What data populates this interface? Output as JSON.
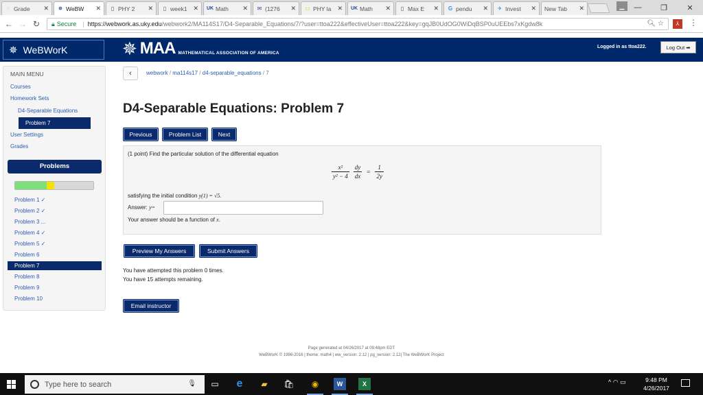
{
  "browser": {
    "tabs": [
      {
        "label": "Grade",
        "icon": "loading-icon"
      },
      {
        "label": "WeBW",
        "icon": "webwork-icon",
        "active": true
      },
      {
        "label": "PHY 2",
        "icon": "page-icon"
      },
      {
        "label": "week1",
        "icon": "page-icon"
      },
      {
        "label": "Math",
        "icon": "uk-icon"
      },
      {
        "label": "(1276",
        "icon": "mail-icon"
      },
      {
        "label": "PHY la",
        "icon": "slides-icon"
      },
      {
        "label": "Math",
        "icon": "uk-icon"
      },
      {
        "label": "Max E",
        "icon": "page-icon"
      },
      {
        "label": "pendu",
        "icon": "google-icon"
      },
      {
        "label": "Invest",
        "icon": "bird-icon"
      },
      {
        "label": "New Tab",
        "icon": "none"
      }
    ],
    "secure_label": "Secure",
    "url_host": "https://webwork.as.uky.edu",
    "url_path": "/webwork2/MA114S17/D4-Separable_Equations/7/?user=ttoa222&effectiveUser=ttoa222&key=gqJB0UdOG0WiDqBSP0uUEEbs7xKgdw8k"
  },
  "header": {
    "app_name": "WeBWorK",
    "maa_name": "MAA",
    "maa_subtitle": "MATHEMATICAL ASSOCIATION OF AMERICA",
    "logged_in": "Logged in as ttoa222.",
    "logout_label": "Log Out"
  },
  "sidebar": {
    "heading": "MAIN MENU",
    "courses": "Courses",
    "homework_sets": "Homework Sets",
    "current_set": "D4-Separable Equations",
    "current_problem": "Problem 7",
    "user_settings": "User Settings",
    "grades": "Grades",
    "problems_title": "Problems",
    "progress": {
      "correct_fraction": 0.4,
      "current_fraction": 0.1
    },
    "problems": [
      "Problem 1 ✓",
      "Problem 2 ✓",
      "Problem 3 ...",
      "Problem 4 ✓",
      "Problem 5 ✓",
      "Problem 6",
      "Problem 7",
      "Problem 8",
      "Problem 9",
      "Problem 10"
    ]
  },
  "main": {
    "breadcrumb": {
      "course": "webwork",
      "set": "ma114s17",
      "problem_set": "d4-separable_equations",
      "problem": "7",
      "sep": "/"
    },
    "title": "D4-Separable Equations: Problem 7",
    "nav_buttons": {
      "previous": "Previous",
      "list": "Problem List",
      "next": "Next"
    },
    "problem": {
      "intro": "(1 point) Find the particular solution of the differential equation",
      "condition_prefix": "satisfying the initial condition ",
      "condition_math": "y(1) = √5.",
      "answer_label": "Answer: ",
      "answer_var": "y=",
      "hint_prefix": "Your answer should be a function of ",
      "hint_var": "x",
      "hint_suffix": "."
    },
    "equation": {
      "lhs_num": "x²",
      "lhs_den": "y² − 4",
      "mid_num": "dy",
      "mid_den": "dx",
      "equals": "=",
      "rhs_num": "1",
      "rhs_den": "2y"
    },
    "actions": {
      "preview": "Preview My Answers",
      "submit": "Submit Answers",
      "email": "Email instructor"
    },
    "attempts_line1": "You have attempted this problem 0 times.",
    "attempts_line2": "You have 15 attempts remaining."
  },
  "footer": {
    "line1": "Page generated at 04/26/2017 at 09:48pm EDT",
    "line2": "WeBWorK © 1996-2016 | theme: math4 | ww_version: 2.12 | pg_version: 2.12| The WeBWorK Project"
  },
  "taskbar": {
    "search_placeholder": "Type here to search",
    "time": "9:48 PM",
    "date": "4/26/2017"
  }
}
